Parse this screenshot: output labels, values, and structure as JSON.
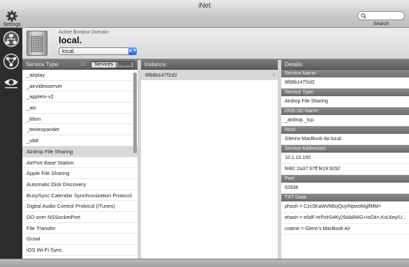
{
  "window": {
    "title": "iNet"
  },
  "toolbar": {
    "settings_label": "Settings",
    "search_label": "Search",
    "search_value": ""
  },
  "sidebar": {
    "icons": [
      "network-icon",
      "bonjour-icon",
      "eye-icon"
    ]
  },
  "domain": {
    "caption": "Active Bonjour Domain:",
    "name": "local.",
    "selected": "local."
  },
  "services": {
    "header": "Service Type:",
    "count": "12",
    "segments": [
      "Services",
      "Hosts"
    ],
    "selected_segment": "Services",
    "items": [
      "_airplay",
      "_airvideoserver",
      "_appletv-v2",
      "_atc",
      "_bbsn",
      "_textexpander",
      "_ubd",
      "Airdrop File Sharing",
      "AirPort Base Station",
      "Apple File Sharing",
      "Automatic Disk Discovery",
      "BusySync Calendar Synchronization Protocol",
      "Digital Audio Control Protocol (iTunes)",
      "DO over NSSocketPort",
      "File Transfer",
      "Growl",
      "iOS Wi-Fi Sync"
    ],
    "selected_index": 7
  },
  "instances": {
    "header": "Instance:",
    "items": [
      "6f68b147f1d2"
    ]
  },
  "details": {
    "header": "Details:",
    "sections": [
      {
        "label": "Service Name:",
        "values": [
          "6f68b147f1d2"
        ]
      },
      {
        "label": "Service Type:",
        "values": [
          "Airdrop File Sharing"
        ]
      },
      {
        "label": "DNS-SD Name:",
        "values": [
          "_airdrop._tcp."
        ]
      },
      {
        "label": "Host:",
        "values": [
          "Glenns-MacBook-Air.local."
        ]
      },
      {
        "label": "Service Addresses:",
        "values": [
          "10.1.10.150",
          "fe80::2a37:37ff:fe19:9292"
        ]
      },
      {
        "label": "Port:",
        "values": [
          "62936"
        ]
      },
      {
        "label": "TXT Data:",
        "values": [
          "phash = CzcSKaWvN8xjQuyINpwoMglfMM=",
          "ehash = e6dF+trPzlrS4Ky29Ab8WG+IoO4=,KvL6ey/U...",
          "cname = Glenn’s MacBook Air"
        ]
      }
    ]
  }
}
